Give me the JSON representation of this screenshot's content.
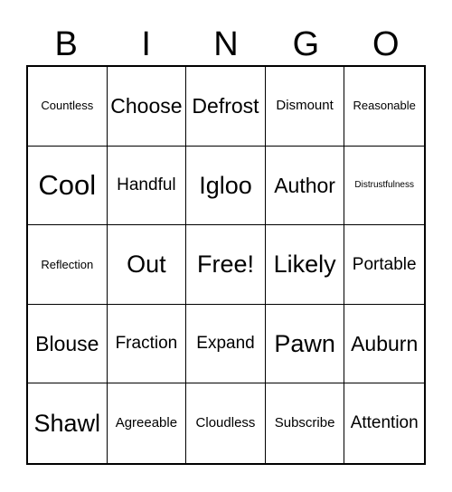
{
  "card": {
    "title_letters": [
      "B",
      "I",
      "N",
      "G",
      "O"
    ],
    "free_space_label": "Free!",
    "rows": [
      [
        {
          "label": "Countless",
          "size": "sm"
        },
        {
          "label": "Choose",
          "size": "xl"
        },
        {
          "label": "Defrost",
          "size": "xl"
        },
        {
          "label": "Dismount",
          "size": "md"
        },
        {
          "label": "Reasonable",
          "size": "sm"
        }
      ],
      [
        {
          "label": "Cool",
          "size": "huge"
        },
        {
          "label": "Handful",
          "size": "lg"
        },
        {
          "label": "Igloo",
          "size": "xxl"
        },
        {
          "label": "Author",
          "size": "xl"
        },
        {
          "label": "Distrustfulness",
          "size": "xs"
        }
      ],
      [
        {
          "label": "Reflection",
          "size": "sm"
        },
        {
          "label": "Out",
          "size": "xxl"
        },
        {
          "label": "Free!",
          "size": "xxl"
        },
        {
          "label": "Likely",
          "size": "xxl"
        },
        {
          "label": "Portable",
          "size": "lg"
        }
      ],
      [
        {
          "label": "Blouse",
          "size": "xl"
        },
        {
          "label": "Fraction",
          "size": "lg"
        },
        {
          "label": "Expand",
          "size": "lg"
        },
        {
          "label": "Pawn",
          "size": "xxl"
        },
        {
          "label": "Auburn",
          "size": "xl"
        }
      ],
      [
        {
          "label": "Shawl",
          "size": "xxl"
        },
        {
          "label": "Agreeable",
          "size": "md"
        },
        {
          "label": "Cloudless",
          "size": "md"
        },
        {
          "label": "Subscribe",
          "size": "md"
        },
        {
          "label": "Attention",
          "size": "lg"
        }
      ]
    ]
  },
  "colors": {
    "background": "#ffffff",
    "text": "#000000",
    "grid_line": "#000000"
  }
}
